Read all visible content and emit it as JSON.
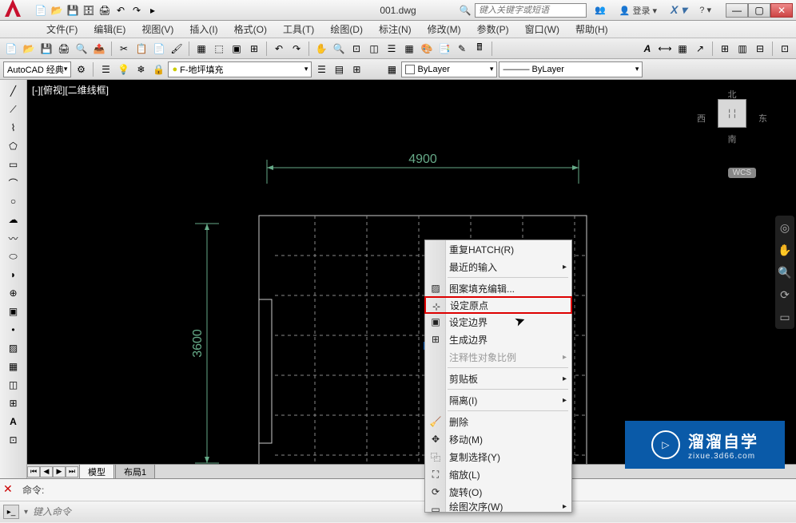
{
  "title": "001.dwg",
  "search_placeholder": "键入关键字或短语",
  "login_label": "登录",
  "menubar": [
    "文件(F)",
    "编辑(E)",
    "视图(V)",
    "插入(I)",
    "格式(O)",
    "工具(T)",
    "绘图(D)",
    "标注(N)",
    "修改(M)",
    "参数(P)",
    "窗口(W)",
    "帮助(H)"
  ],
  "workspace": "AutoCAD 经典",
  "layer_dropdown": "F-地坪填充",
  "bylayer1": "ByLayer",
  "bylayer2": "ByLayer",
  "viewport_label": "[-][俯视][二维线框]",
  "viewcube": {
    "n": "北",
    "s": "南",
    "e": "东",
    "w": "西",
    "wcs": "WCS"
  },
  "dimensions": {
    "width": "4900",
    "height": "3600"
  },
  "context_menu": [
    {
      "label": "重复HATCH(R)",
      "type": "item"
    },
    {
      "label": "最近的输入",
      "type": "submenu"
    },
    {
      "type": "sep"
    },
    {
      "label": "图案填充编辑...",
      "type": "item",
      "icon": "hatch-edit"
    },
    {
      "label": "设定原点",
      "type": "item",
      "icon": "origin",
      "highlighted": true
    },
    {
      "label": "设定边界",
      "type": "item",
      "icon": "boundary"
    },
    {
      "label": "生成边界",
      "type": "item",
      "icon": "gen-boundary"
    },
    {
      "label": "注释性对象比例",
      "type": "submenu",
      "disabled": true
    },
    {
      "type": "sep"
    },
    {
      "label": "剪贴板",
      "type": "submenu"
    },
    {
      "type": "sep"
    },
    {
      "label": "隔离(I)",
      "type": "submenu"
    },
    {
      "type": "sep"
    },
    {
      "label": "删除",
      "type": "item",
      "icon": "erase"
    },
    {
      "label": "移动(M)",
      "type": "item",
      "icon": "move"
    },
    {
      "label": "复制选择(Y)",
      "type": "item",
      "icon": "copy"
    },
    {
      "label": "缩放(L)",
      "type": "item",
      "icon": "scale"
    },
    {
      "label": "旋转(O)",
      "type": "item",
      "icon": "rotate"
    },
    {
      "label": "绘图次序(W)",
      "type": "submenu",
      "cut": true
    }
  ],
  "tabs": {
    "model": "模型",
    "layout1": "布局1"
  },
  "command": {
    "prompt": "命令:",
    "placeholder": "键入命令"
  },
  "watermark": {
    "main": "溜溜自学",
    "sub": "zixue.3d66.com"
  }
}
